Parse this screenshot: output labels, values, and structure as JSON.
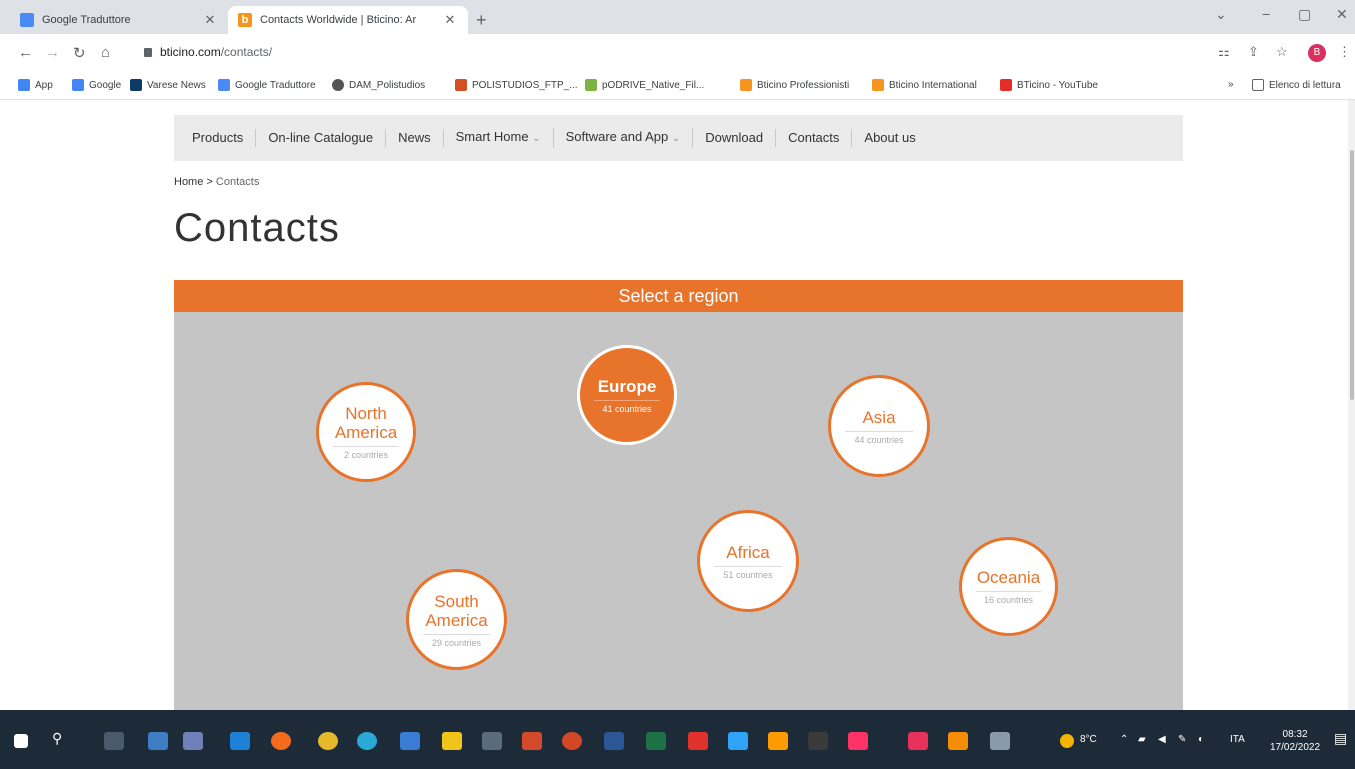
{
  "browser": {
    "tabs": [
      {
        "title": "Google Traduttore",
        "active": false
      },
      {
        "title": "Contacts Worldwide | Bticino: Ar",
        "active": true
      }
    ],
    "new_tab": "+",
    "url_host": "bticino.com",
    "url_path": "/contacts/",
    "profile_initial": "B",
    "bookmarks": [
      {
        "label": "App",
        "icon": "apps-grid-icon",
        "color": "#4285f4"
      },
      {
        "label": "Google",
        "icon": "google-icon",
        "color": "#4285f4"
      },
      {
        "label": "Varese News",
        "icon": "vn-icon",
        "color": "#0d3b66"
      },
      {
        "label": "Google Traduttore",
        "icon": "translate-icon",
        "color": "#4a8af4"
      },
      {
        "label": "DAM_Polistudios",
        "icon": "globe-icon",
        "color": "#555555"
      },
      {
        "label": "POLISTUDIOS_FTP_...",
        "icon": "ftp-icon",
        "color": "#d44f21"
      },
      {
        "label": "pODRIVE_Native_Fil...",
        "icon": "drive-icon",
        "color": "#7cb342"
      },
      {
        "label": "Bticino Professionisti",
        "icon": "bticino-icon",
        "color": "#f7941d"
      },
      {
        "label": "Bticino International",
        "icon": "bticino-icon",
        "color": "#f7941d"
      },
      {
        "label": "BTicino - YouTube",
        "icon": "youtube-icon",
        "color": "#e52d27"
      }
    ],
    "more_bookmarks": "»",
    "reading_list": "Elenco di lettura"
  },
  "site": {
    "nav": [
      "Products",
      "On-line Catalogue",
      "News",
      "Smart Home",
      "Software and App",
      "Download",
      "Contacts",
      "About us"
    ],
    "breadcrumb": {
      "home": "Home",
      "sep": ">",
      "current": "Contacts"
    },
    "title": "Contacts",
    "region_header": "Select a region",
    "regions": [
      {
        "name1": "North",
        "name2": "America",
        "count": "2 countries",
        "selected": false
      },
      {
        "name1": "Europe",
        "name2": "",
        "count": "41 countries",
        "selected": true
      },
      {
        "name1": "Asia",
        "name2": "",
        "count": "44 countries",
        "selected": false
      },
      {
        "name1": "Africa",
        "name2": "",
        "count": "51 countries",
        "selected": false
      },
      {
        "name1": "South",
        "name2": "America",
        "count": "29 countries",
        "selected": false
      },
      {
        "name1": "Oceania",
        "name2": "",
        "count": "16 countries",
        "selected": false
      }
    ]
  },
  "taskbar": {
    "weather": "8°C",
    "language": "ITA",
    "time": "08:32",
    "date": "17/02/2022"
  },
  "colors": {
    "brand_orange": "#e8732a",
    "region_bg": "#c5c5c5",
    "nav_bg": "#ebebeb"
  }
}
